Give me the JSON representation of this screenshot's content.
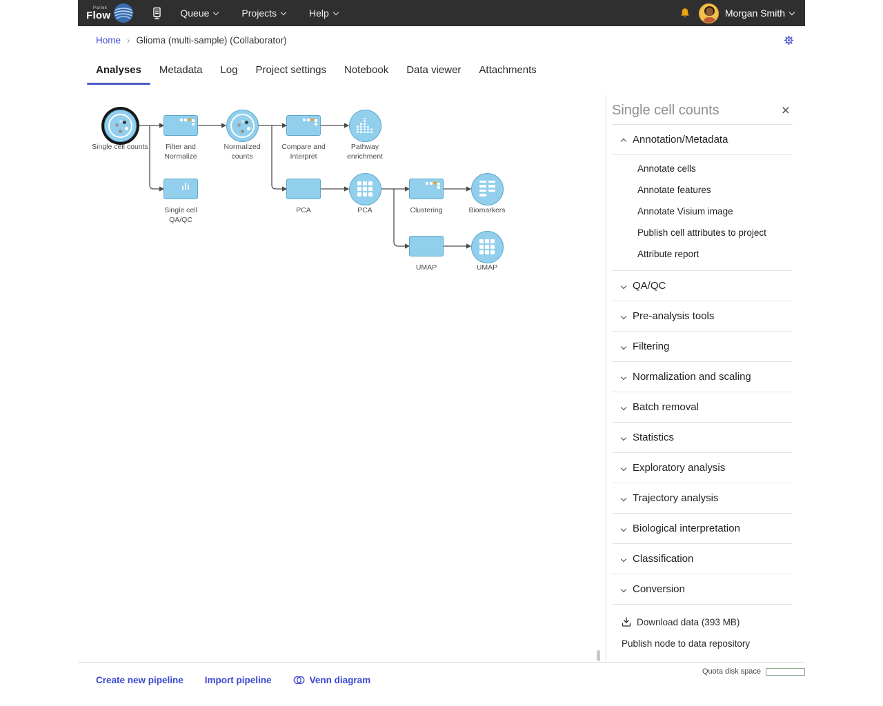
{
  "navbar": {
    "brand_top": "Partek",
    "brand": "Flow",
    "menu": [
      {
        "label": "Queue"
      },
      {
        "label": "Projects"
      },
      {
        "label": "Help"
      }
    ],
    "user_name": "Morgan Smith"
  },
  "breadcrumb": {
    "home": "Home",
    "separator": "›",
    "current": "Glioma (multi-sample) (Collaborator)"
  },
  "tabs": [
    {
      "label": "Analyses",
      "active": true
    },
    {
      "label": "Metadata",
      "active": false
    },
    {
      "label": "Log",
      "active": false
    },
    {
      "label": "Project settings",
      "active": false
    },
    {
      "label": "Notebook",
      "active": false
    },
    {
      "label": "Data viewer",
      "active": false
    },
    {
      "label": "Attachments",
      "active": false
    }
  ],
  "pipeline": {
    "nodes": [
      {
        "id": "single-cell-counts",
        "kind": "data-circle",
        "icon": "cell-icon",
        "label": "Single cell counts",
        "selected": true
      },
      {
        "id": "filter-and-normalize",
        "kind": "task-rect",
        "icon": "tasks-icon",
        "label": "Filter and Normalize",
        "selected": false
      },
      {
        "id": "normalized-counts",
        "kind": "data-circle",
        "icon": "cell-icon",
        "label": "Normalized counts",
        "selected": false
      },
      {
        "id": "compare-and-interpret",
        "kind": "task-rect",
        "icon": "tasks-icon",
        "label": "Compare and Interpret",
        "selected": false
      },
      {
        "id": "pathway-enrichment",
        "kind": "data-circle",
        "icon": "histogram-icon",
        "label": "Pathway enrichment",
        "selected": false
      },
      {
        "id": "single-cell-qaqc",
        "kind": "task-rect",
        "icon": "bar-chart-icon",
        "label": "Single cell QA/QC",
        "selected": false
      },
      {
        "id": "pca-task",
        "kind": "task-rect",
        "icon": "none",
        "label": "PCA",
        "selected": false
      },
      {
        "id": "pca-data",
        "kind": "data-circle",
        "icon": "grid-icon",
        "label": "PCA",
        "selected": false
      },
      {
        "id": "clustering",
        "kind": "task-rect",
        "icon": "tasks-icon",
        "label": "Clustering",
        "selected": false
      },
      {
        "id": "biomarkers",
        "kind": "data-circle",
        "icon": "table-icon",
        "label": "Biomarkers",
        "selected": false
      },
      {
        "id": "umap-task",
        "kind": "task-rect",
        "icon": "none",
        "label": "UMAP",
        "selected": false
      },
      {
        "id": "umap-data",
        "kind": "data-circle",
        "icon": "grid-icon",
        "label": "UMAP",
        "selected": false
      }
    ],
    "edges": [
      {
        "from": "single-cell-counts",
        "to": "filter-and-normalize"
      },
      {
        "from": "single-cell-counts",
        "to": "single-cell-qaqc"
      },
      {
        "from": "filter-and-normalize",
        "to": "normalized-counts"
      },
      {
        "from": "normalized-counts",
        "to": "compare-and-interpret"
      },
      {
        "from": "normalized-counts",
        "to": "pca-task"
      },
      {
        "from": "compare-and-interpret",
        "to": "pathway-enrichment"
      },
      {
        "from": "pca-task",
        "to": "pca-data"
      },
      {
        "from": "pca-data",
        "to": "clustering"
      },
      {
        "from": "pca-data",
        "to": "umap-task"
      },
      {
        "from": "clustering",
        "to": "biomarkers"
      },
      {
        "from": "umap-task",
        "to": "umap-data"
      }
    ]
  },
  "panel": {
    "title": "Single cell counts",
    "sections": [
      {
        "label": "Annotation/Metadata",
        "expanded": true,
        "items": [
          "Annotate cells",
          "Annotate features",
          "Annotate Visium image",
          "Publish cell attributes to project",
          "Attribute report"
        ]
      },
      {
        "label": "QA/QC",
        "expanded": false
      },
      {
        "label": "Pre-analysis tools",
        "expanded": false
      },
      {
        "label": "Filtering",
        "expanded": false
      },
      {
        "label": "Normalization and scaling",
        "expanded": false
      },
      {
        "label": "Batch removal",
        "expanded": false
      },
      {
        "label": "Statistics",
        "expanded": false
      },
      {
        "label": "Exploratory analysis",
        "expanded": false
      },
      {
        "label": "Trajectory analysis",
        "expanded": false
      },
      {
        "label": "Biological interpretation",
        "expanded": false
      },
      {
        "label": "Classification",
        "expanded": false
      },
      {
        "label": "Conversion",
        "expanded": false
      }
    ],
    "download_label": "Download data (393 MB)",
    "publish_label": "Publish node to data repository"
  },
  "footer": {
    "links": [
      "Create new pipeline",
      "Import pipeline",
      "Venn diagram"
    ],
    "quota_label": "Quota disk space"
  },
  "colors": {
    "accent_link": "#3f4ed0",
    "tab_underline": "#4d5bc9",
    "node_fill": "#92cfec",
    "node_border": "#5ea6cc",
    "selected_ring": "#161616",
    "navbar_bg": "#2f2f2f",
    "bell": "#eda010"
  }
}
